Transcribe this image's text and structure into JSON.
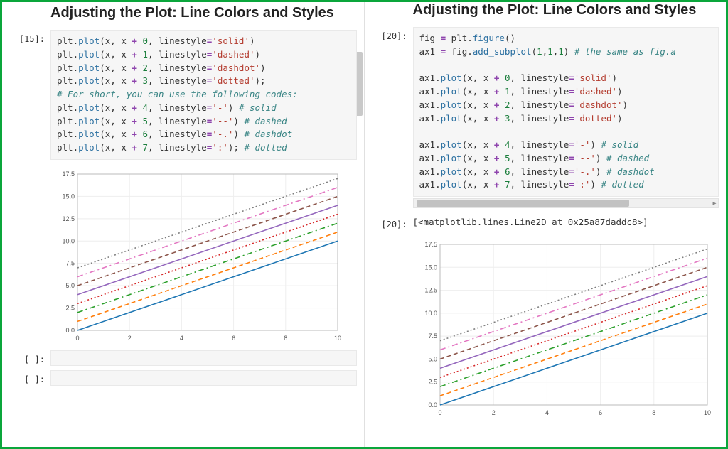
{
  "left": {
    "title": "Adjusting the Plot: Line Colors and Styles",
    "prompt_in": "[15]:",
    "empty_prompt": "[ ]:",
    "code_tokens": [
      [
        [
          "plt",
          "ident"
        ],
        [
          ".",
          "punct"
        ],
        [
          "plot",
          "fn"
        ],
        [
          "(x, x ",
          "ident"
        ],
        [
          "+",
          "op"
        ],
        [
          " ",
          "ident"
        ],
        [
          "0",
          "num"
        ],
        [
          ", linestyle",
          "ident"
        ],
        [
          "=",
          "op"
        ],
        [
          "'solid'",
          "str"
        ],
        [
          ")",
          "punct"
        ]
      ],
      [
        [
          "plt",
          "ident"
        ],
        [
          ".",
          "punct"
        ],
        [
          "plot",
          "fn"
        ],
        [
          "(x, x ",
          "ident"
        ],
        [
          "+",
          "op"
        ],
        [
          " ",
          "ident"
        ],
        [
          "1",
          "num"
        ],
        [
          ", linestyle",
          "ident"
        ],
        [
          "=",
          "op"
        ],
        [
          "'dashed'",
          "str"
        ],
        [
          ")",
          "punct"
        ]
      ],
      [
        [
          "plt",
          "ident"
        ],
        [
          ".",
          "punct"
        ],
        [
          "plot",
          "fn"
        ],
        [
          "(x, x ",
          "ident"
        ],
        [
          "+",
          "op"
        ],
        [
          " ",
          "ident"
        ],
        [
          "2",
          "num"
        ],
        [
          ", linestyle",
          "ident"
        ],
        [
          "=",
          "op"
        ],
        [
          "'dashdot'",
          "str"
        ],
        [
          ")",
          "punct"
        ]
      ],
      [
        [
          "plt",
          "ident"
        ],
        [
          ".",
          "punct"
        ],
        [
          "plot",
          "fn"
        ],
        [
          "(x, x ",
          "ident"
        ],
        [
          "+",
          "op"
        ],
        [
          " ",
          "ident"
        ],
        [
          "3",
          "num"
        ],
        [
          ", linestyle",
          "ident"
        ],
        [
          "=",
          "op"
        ],
        [
          "'dotted'",
          "str"
        ],
        [
          ");",
          "punct"
        ]
      ],
      [
        [
          "# For short, you can use the following codes:",
          "cmt"
        ]
      ],
      [
        [
          "plt",
          "ident"
        ],
        [
          ".",
          "punct"
        ],
        [
          "plot",
          "fn"
        ],
        [
          "(x, x ",
          "ident"
        ],
        [
          "+",
          "op"
        ],
        [
          " ",
          "ident"
        ],
        [
          "4",
          "num"
        ],
        [
          ", linestyle",
          "ident"
        ],
        [
          "=",
          "op"
        ],
        [
          "'-'",
          "str"
        ],
        [
          ") ",
          "punct"
        ],
        [
          "# solid",
          "cmt"
        ]
      ],
      [
        [
          "plt",
          "ident"
        ],
        [
          ".",
          "punct"
        ],
        [
          "plot",
          "fn"
        ],
        [
          "(x, x ",
          "ident"
        ],
        [
          "+",
          "op"
        ],
        [
          " ",
          "ident"
        ],
        [
          "5",
          "num"
        ],
        [
          ", linestyle",
          "ident"
        ],
        [
          "=",
          "op"
        ],
        [
          "'--'",
          "str"
        ],
        [
          ") ",
          "punct"
        ],
        [
          "# dashed",
          "cmt"
        ]
      ],
      [
        [
          "plt",
          "ident"
        ],
        [
          ".",
          "punct"
        ],
        [
          "plot",
          "fn"
        ],
        [
          "(x, x ",
          "ident"
        ],
        [
          "+",
          "op"
        ],
        [
          " ",
          "ident"
        ],
        [
          "6",
          "num"
        ],
        [
          ", linestyle",
          "ident"
        ],
        [
          "=",
          "op"
        ],
        [
          "'-.'",
          "str"
        ],
        [
          ") ",
          "punct"
        ],
        [
          "# dashdot",
          "cmt"
        ]
      ],
      [
        [
          "plt",
          "ident"
        ],
        [
          ".",
          "punct"
        ],
        [
          "plot",
          "fn"
        ],
        [
          "(x, x ",
          "ident"
        ],
        [
          "+",
          "op"
        ],
        [
          " ",
          "ident"
        ],
        [
          "7",
          "num"
        ],
        [
          ", linestyle",
          "ident"
        ],
        [
          "=",
          "op"
        ],
        [
          "':'",
          "str"
        ],
        [
          "); ",
          "punct"
        ],
        [
          "# dotted",
          "cmt"
        ]
      ]
    ]
  },
  "right": {
    "title": "Adjusting the Plot: Line Colors and Styles",
    "prompt_in": "[20]:",
    "prompt_out": "[20]:",
    "out_text": "[<matplotlib.lines.Line2D at 0x25a87daddc8>]",
    "code_tokens": [
      [
        [
          "fig ",
          "ident"
        ],
        [
          "=",
          "op"
        ],
        [
          " plt",
          "ident"
        ],
        [
          ".",
          "punct"
        ],
        [
          "figure",
          "fn"
        ],
        [
          "()",
          "punct"
        ]
      ],
      [
        [
          "ax1 ",
          "ident"
        ],
        [
          "=",
          "op"
        ],
        [
          " fig",
          "ident"
        ],
        [
          ".",
          "punct"
        ],
        [
          "add_subplot",
          "fn"
        ],
        [
          "(",
          "punct"
        ],
        [
          "1",
          "num"
        ],
        [
          ",",
          "punct"
        ],
        [
          "1",
          "num"
        ],
        [
          ",",
          "punct"
        ],
        [
          "1",
          "num"
        ],
        [
          ") ",
          "punct"
        ],
        [
          "# the same as fig.a",
          "cmt"
        ]
      ],
      [
        [
          "",
          "ident"
        ]
      ],
      [
        [
          "ax1",
          "ident"
        ],
        [
          ".",
          "punct"
        ],
        [
          "plot",
          "fn"
        ],
        [
          "(x, x ",
          "ident"
        ],
        [
          "+",
          "op"
        ],
        [
          " ",
          "ident"
        ],
        [
          "0",
          "num"
        ],
        [
          ", linestyle",
          "ident"
        ],
        [
          "=",
          "op"
        ],
        [
          "'solid'",
          "str"
        ],
        [
          ")",
          "punct"
        ]
      ],
      [
        [
          "ax1",
          "ident"
        ],
        [
          ".",
          "punct"
        ],
        [
          "plot",
          "fn"
        ],
        [
          "(x, x ",
          "ident"
        ],
        [
          "+",
          "op"
        ],
        [
          " ",
          "ident"
        ],
        [
          "1",
          "num"
        ],
        [
          ", linestyle",
          "ident"
        ],
        [
          "=",
          "op"
        ],
        [
          "'dashed'",
          "str"
        ],
        [
          ")",
          "punct"
        ]
      ],
      [
        [
          "ax1",
          "ident"
        ],
        [
          ".",
          "punct"
        ],
        [
          "plot",
          "fn"
        ],
        [
          "(x, x ",
          "ident"
        ],
        [
          "+",
          "op"
        ],
        [
          " ",
          "ident"
        ],
        [
          "2",
          "num"
        ],
        [
          ", linestyle",
          "ident"
        ],
        [
          "=",
          "op"
        ],
        [
          "'dashdot'",
          "str"
        ],
        [
          ")",
          "punct"
        ]
      ],
      [
        [
          "ax1",
          "ident"
        ],
        [
          ".",
          "punct"
        ],
        [
          "plot",
          "fn"
        ],
        [
          "(x, x ",
          "ident"
        ],
        [
          "+",
          "op"
        ],
        [
          " ",
          "ident"
        ],
        [
          "3",
          "num"
        ],
        [
          ", linestyle",
          "ident"
        ],
        [
          "=",
          "op"
        ],
        [
          "'dotted'",
          "str"
        ],
        [
          ")",
          "punct"
        ]
      ],
      [
        [
          "",
          "ident"
        ]
      ],
      [
        [
          "ax1",
          "ident"
        ],
        [
          ".",
          "punct"
        ],
        [
          "plot",
          "fn"
        ],
        [
          "(x, x ",
          "ident"
        ],
        [
          "+",
          "op"
        ],
        [
          " ",
          "ident"
        ],
        [
          "4",
          "num"
        ],
        [
          ", linestyle",
          "ident"
        ],
        [
          "=",
          "op"
        ],
        [
          "'-'",
          "str"
        ],
        [
          ") ",
          "punct"
        ],
        [
          "# solid",
          "cmt"
        ]
      ],
      [
        [
          "ax1",
          "ident"
        ],
        [
          ".",
          "punct"
        ],
        [
          "plot",
          "fn"
        ],
        [
          "(x, x ",
          "ident"
        ],
        [
          "+",
          "op"
        ],
        [
          " ",
          "ident"
        ],
        [
          "5",
          "num"
        ],
        [
          ", linestyle",
          "ident"
        ],
        [
          "=",
          "op"
        ],
        [
          "'--'",
          "str"
        ],
        [
          ") ",
          "punct"
        ],
        [
          "# dashed",
          "cmt"
        ]
      ],
      [
        [
          "ax1",
          "ident"
        ],
        [
          ".",
          "punct"
        ],
        [
          "plot",
          "fn"
        ],
        [
          "(x, x ",
          "ident"
        ],
        [
          "+",
          "op"
        ],
        [
          " ",
          "ident"
        ],
        [
          "6",
          "num"
        ],
        [
          ", linestyle",
          "ident"
        ],
        [
          "=",
          "op"
        ],
        [
          "'-.'",
          "str"
        ],
        [
          ") ",
          "punct"
        ],
        [
          "# dashdot",
          "cmt"
        ]
      ],
      [
        [
          "ax1",
          "ident"
        ],
        [
          ".",
          "punct"
        ],
        [
          "plot",
          "fn"
        ],
        [
          "(x, x ",
          "ident"
        ],
        [
          "+",
          "op"
        ],
        [
          " ",
          "ident"
        ],
        [
          "7",
          "num"
        ],
        [
          ", linestyle",
          "ident"
        ],
        [
          "=",
          "op"
        ],
        [
          "':'",
          "str"
        ],
        [
          ") ",
          "punct"
        ],
        [
          "# dotted",
          "cmt"
        ]
      ]
    ]
  },
  "chart_data": {
    "type": "line",
    "x": [
      0,
      2,
      4,
      6,
      8,
      10
    ],
    "xlim": [
      0,
      10
    ],
    "ylim": [
      0,
      17.5
    ],
    "xticks": [
      0,
      2,
      4,
      6,
      8,
      10
    ],
    "yticks": [
      0.0,
      2.5,
      5.0,
      7.5,
      10.0,
      12.5,
      15.0,
      17.5
    ],
    "series": [
      {
        "name": "x+0",
        "offset": 0,
        "color": "#1f77b4",
        "dash": ""
      },
      {
        "name": "x+1",
        "offset": 1,
        "color": "#ff7f0e",
        "dash": "6 4"
      },
      {
        "name": "x+2",
        "offset": 2,
        "color": "#2ca02c",
        "dash": "8 4 2 4"
      },
      {
        "name": "x+3",
        "offset": 3,
        "color": "#d62728",
        "dash": "2 3"
      },
      {
        "name": "x+4",
        "offset": 4,
        "color": "#9467bd",
        "dash": ""
      },
      {
        "name": "x+5",
        "offset": 5,
        "color": "#8c564b",
        "dash": "6 4"
      },
      {
        "name": "x+6",
        "offset": 6,
        "color": "#e377c2",
        "dash": "8 4 2 4"
      },
      {
        "name": "x+7",
        "offset": 7,
        "color": "#7f7f7f",
        "dash": "2 3"
      }
    ]
  }
}
